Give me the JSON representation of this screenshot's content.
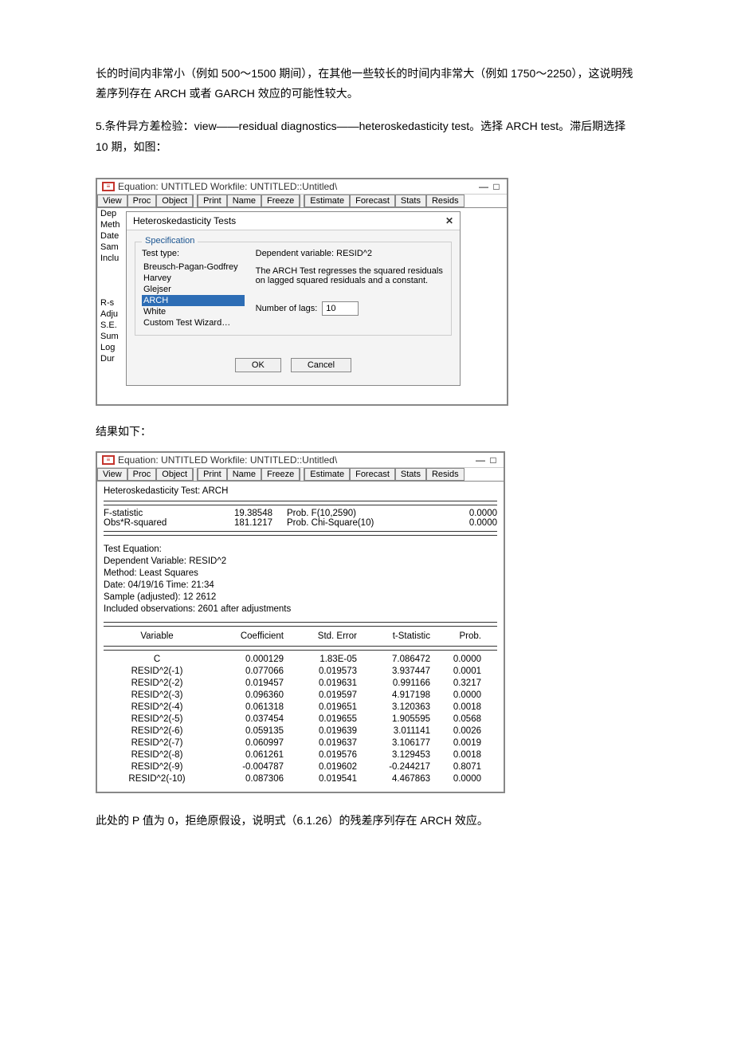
{
  "intro": {
    "p1": "长的时间内非常小（例如 500～1500 期间），在其他一些较长的时间内非常大（例如 1750～2250），这说明残差序列存在 ARCH 或者 GARCH 效应的可能性较大。",
    "p2": "5.条件异方差检验：view——residual diagnostics——heteroskedasticity test。选择 ARCH test。滞后期选择 10 期，如图："
  },
  "win1": {
    "title": "Equation: UNTITLED   Workfile: UNTITLED::Untitled\\",
    "toolbar": [
      "View",
      "Proc",
      "Object",
      "Print",
      "Name",
      "Freeze",
      "Estimate",
      "Forecast",
      "Stats",
      "Resids"
    ],
    "sideLabels": "Dep\nMeth\nDate\nSam\nInclu\n\n\n\nR-s\nAdju\nS.E.\nSum\nLog\nDur",
    "dialog": {
      "title": "Heteroskedasticity Tests",
      "legend": "Specification",
      "testTypeLabel": "Test type:",
      "tests": [
        "Breusch-Pagan-Godfrey",
        "Harvey",
        "Glejser",
        "ARCH",
        "White",
        "Custom Test Wizard…"
      ],
      "selectedIndex": 3,
      "depLine": "Dependent variable: RESID^2",
      "desc": "The ARCH Test regresses the squared residuals on lagged squared residuals and a constant.",
      "lagsLabel": "Number of lags:",
      "lagsValue": "10",
      "ok": "OK",
      "cancel": "Cancel"
    }
  },
  "midText": "结果如下：",
  "win2": {
    "title": "Equation: UNTITLED   Workfile: UNTITLED::Untitled\\",
    "toolbar": [
      "View",
      "Proc",
      "Object",
      "Print",
      "Name",
      "Freeze",
      "Estimate",
      "Forecast",
      "Stats",
      "Resids"
    ],
    "section": "Heteroskedasticity Test: ARCH",
    "stats": [
      {
        "l": "F-statistic",
        "v": "19.38548",
        "d": "Prob. F(10,2590)",
        "p": "0.0000"
      },
      {
        "l": "Obs*R-squared",
        "v": "181.1217",
        "d": "Prob. Chi-Square(10)",
        "p": "0.0000"
      }
    ],
    "meta": [
      "Test Equation:",
      "Dependent Variable: RESID^2",
      "Method: Least Squares",
      "Date: 04/19/16   Time: 21:34",
      "Sample (adjusted): 12 2612",
      "Included observations: 2601 after adjustments"
    ],
    "head": {
      "v": "Variable",
      "c": "Coefficient",
      "s": "Std. Error",
      "t": "t-Statistic",
      "p": "Prob."
    },
    "rows": [
      {
        "v": "C",
        "c": "0.000129",
        "s": "1.83E-05",
        "t": "7.086472",
        "p": "0.0000"
      },
      {
        "v": "RESID^2(-1)",
        "c": "0.077066",
        "s": "0.019573",
        "t": "3.937447",
        "p": "0.0001"
      },
      {
        "v": "RESID^2(-2)",
        "c": "0.019457",
        "s": "0.019631",
        "t": "0.991166",
        "p": "0.3217"
      },
      {
        "v": "RESID^2(-3)",
        "c": "0.096360",
        "s": "0.019597",
        "t": "4.917198",
        "p": "0.0000"
      },
      {
        "v": "RESID^2(-4)",
        "c": "0.061318",
        "s": "0.019651",
        "t": "3.120363",
        "p": "0.0018"
      },
      {
        "v": "RESID^2(-5)",
        "c": "0.037454",
        "s": "0.019655",
        "t": "1.905595",
        "p": "0.0568"
      },
      {
        "v": "RESID^2(-6)",
        "c": "0.059135",
        "s": "0.019639",
        "t": "3.011141",
        "p": "0.0026"
      },
      {
        "v": "RESID^2(-7)",
        "c": "0.060997",
        "s": "0.019637",
        "t": "3.106177",
        "p": "0.0019"
      },
      {
        "v": "RESID^2(-8)",
        "c": "0.061261",
        "s": "0.019576",
        "t": "3.129453",
        "p": "0.0018"
      },
      {
        "v": "RESID^2(-9)",
        "c": "-0.004787",
        "s": "0.019602",
        "t": "-0.244217",
        "p": "0.8071"
      },
      {
        "v": "RESID^2(-10)",
        "c": "0.087306",
        "s": "0.019541",
        "t": "4.467863",
        "p": "0.0000"
      }
    ]
  },
  "final": "此处的 P 值为 0，拒绝原假设，说明式（6.1.26）的残差序列存在 ARCH 效应。"
}
